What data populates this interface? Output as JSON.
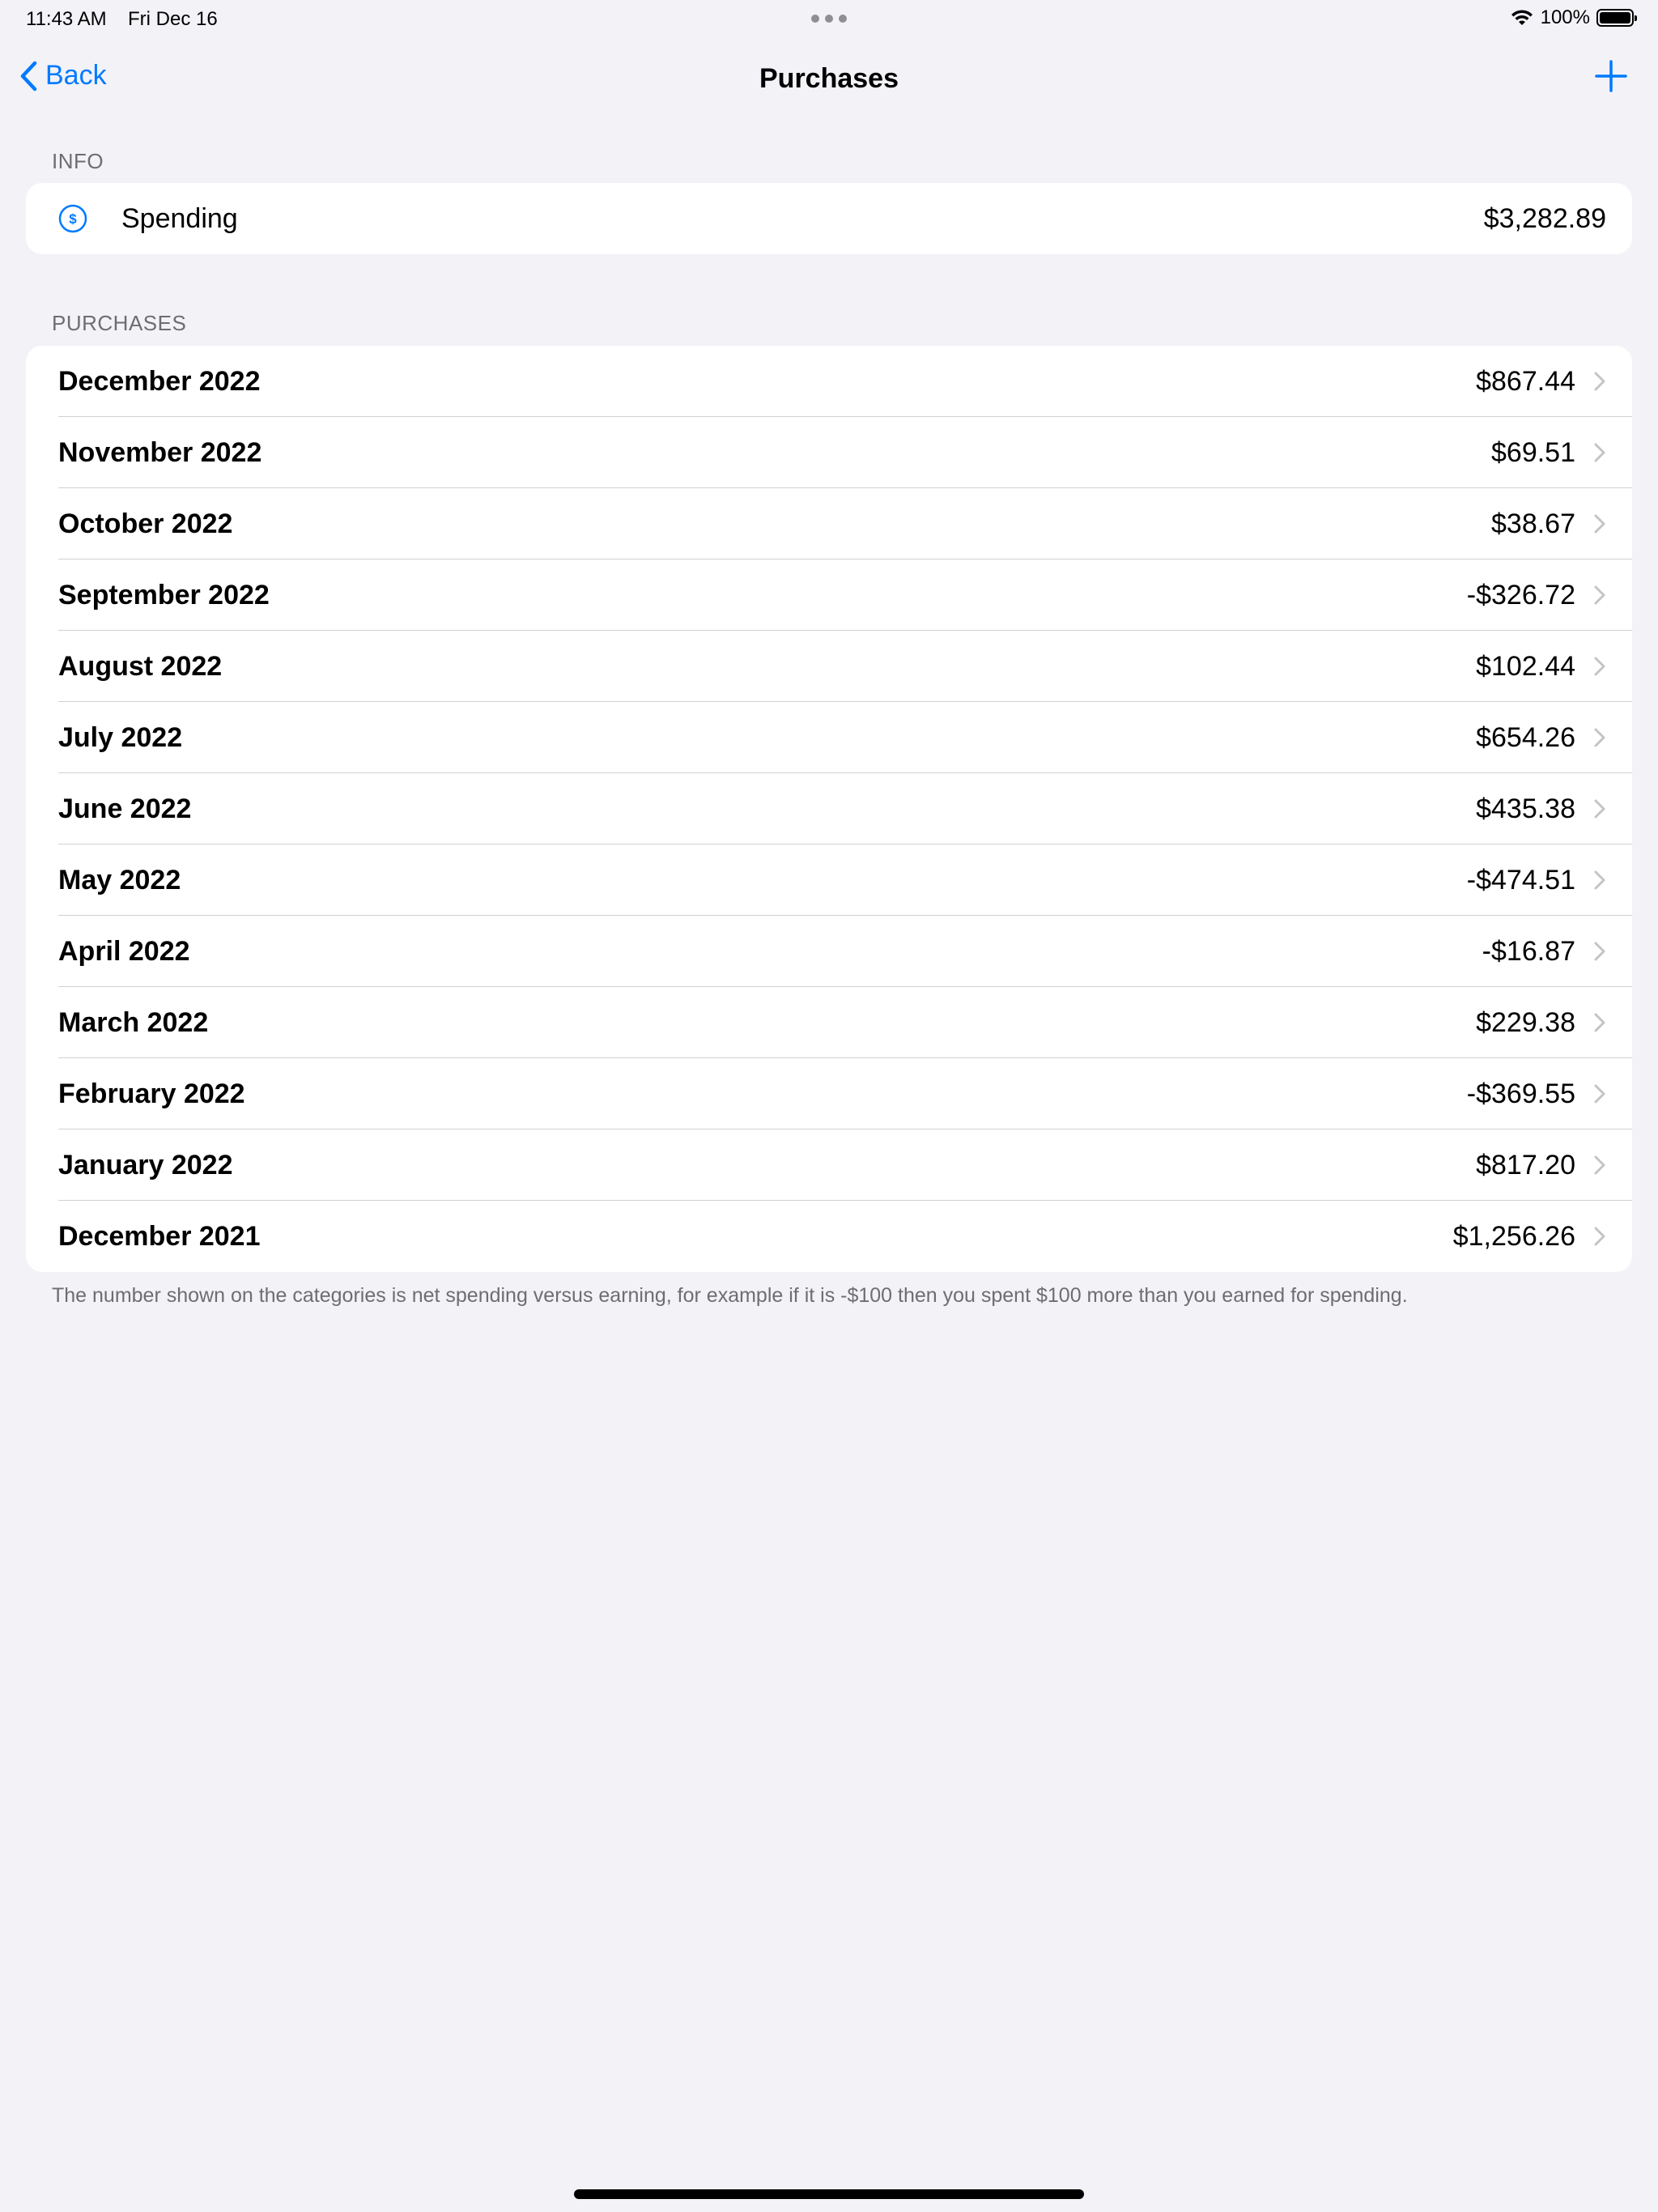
{
  "status_bar": {
    "time": "11:43 AM",
    "date": "Fri Dec 16",
    "battery": "100%",
    "battery_level": 1.0
  },
  "nav": {
    "back_label": "Back",
    "title": "Purchases",
    "add_icon": "plus-icon"
  },
  "info": {
    "header": "INFO",
    "label": "Spending",
    "value": "$3,282.89",
    "icon": "dollar-circle-icon"
  },
  "purchases": {
    "header": "PURCHASES",
    "rows": [
      {
        "label": "December 2022",
        "value": "$867.44"
      },
      {
        "label": "November 2022",
        "value": "$69.51"
      },
      {
        "label": "October 2022",
        "value": "$38.67"
      },
      {
        "label": "September 2022",
        "value": "-$326.72"
      },
      {
        "label": "August 2022",
        "value": "$102.44"
      },
      {
        "label": "July 2022",
        "value": "$654.26"
      },
      {
        "label": "June 2022",
        "value": "$435.38"
      },
      {
        "label": "May 2022",
        "value": "-$474.51"
      },
      {
        "label": "April 2022",
        "value": "-$16.87"
      },
      {
        "label": "March 2022",
        "value": "$229.38"
      },
      {
        "label": "February 2022",
        "value": "-$369.55"
      },
      {
        "label": "January 2022",
        "value": "$817.20"
      },
      {
        "label": "December 2021",
        "value": "$1,256.26"
      }
    ],
    "footer": "The number shown on the categories is net spending versus earning, for example if it is -$100 then you spent $100 more than you earned for spending."
  },
  "colors": {
    "accent": "#007aff",
    "background": "#f2f2f7",
    "secondary_text": "#6d6d72"
  }
}
